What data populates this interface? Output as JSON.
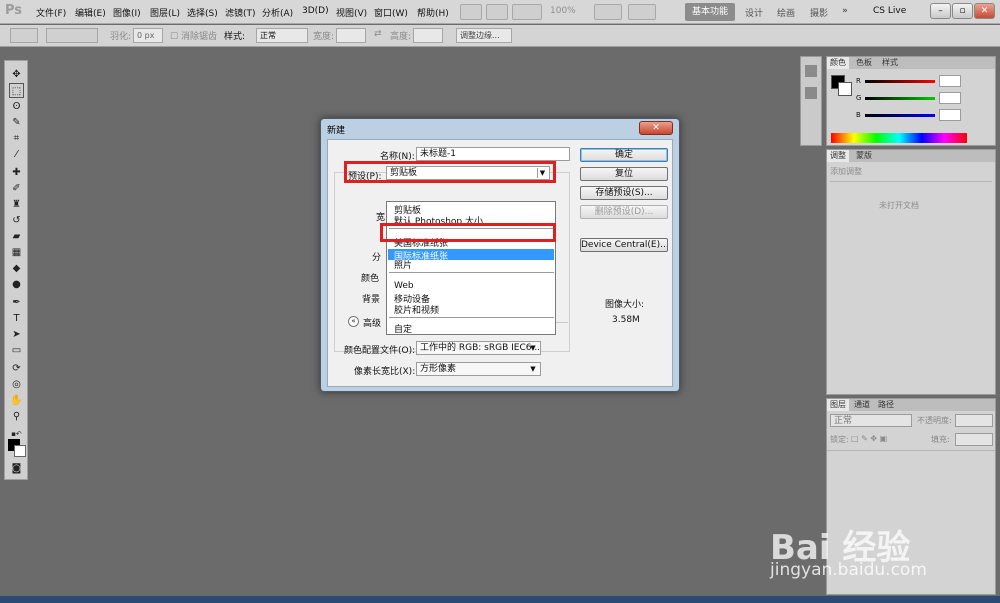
{
  "menubar": {
    "logo": "Ps",
    "items": [
      "文件(F)",
      "编辑(E)",
      "图像(I)",
      "图层(L)",
      "选择(S)",
      "滤镜(T)",
      "分析(A)",
      "3D(D)",
      "视图(V)",
      "窗口(W)",
      "帮助(H)"
    ],
    "zoom": "100%",
    "workspaces": [
      "基本功能",
      "设计",
      "绘画",
      "摄影",
      "»"
    ],
    "cs_live": "CS Live",
    "window_controls": [
      "–",
      "▫",
      "✕"
    ]
  },
  "optionsbar": {
    "feather_label": "羽化:",
    "feather_value": "0 px",
    "antialias_label": "消除锯齿",
    "style_label": "样式:",
    "style_value": "正常",
    "width_label": "宽度:",
    "height_label": "高度:",
    "refine_edge": "调整边缘..."
  },
  "panels": {
    "color_tabs": [
      "颜色",
      "色板",
      "样式"
    ],
    "rgb_labels": [
      "R",
      "G",
      "B"
    ],
    "adjust_tabs": [
      "调整",
      "蒙版"
    ],
    "adjust_header": "添加调整",
    "adjust_empty": "未打开文档",
    "layers_tabs": [
      "图层",
      "通道",
      "路径"
    ],
    "blend_mode": "正常",
    "opacity_label": "不透明度:",
    "lock_label": "锁定:",
    "fill_label": "填充:"
  },
  "dialog": {
    "title": "新建",
    "close": "✕",
    "name_label": "名称(N):",
    "name_value": "未标题-1",
    "preset_label": "预设(P):",
    "preset_value": "剪贴板",
    "partial_labels": [
      "宽",
      "分",
      "颜色",
      "背景"
    ],
    "advanced_label": "高级",
    "color_profile_label": "颜色配置文件(O):",
    "color_profile_value": "工作中的 RGB: sRGB IEC6...",
    "pixel_aspect_label": "像素长宽比(X):",
    "pixel_aspect_value": "方形像素",
    "buttons": {
      "ok": "确定",
      "reset": "复位",
      "save_preset": "存储预设(S)...",
      "delete_preset": "删除预设(D)...",
      "device_central": "Device Central(E)..."
    },
    "image_size_label": "图像大小:",
    "image_size_value": "3.58M",
    "preset_options": {
      "clipboard": "剪贴板",
      "default": "默认 Photoshop 大小",
      "us_paper": "美国标准纸张",
      "intl_paper": "国际标准纸张",
      "photo": "照片",
      "web": "Web",
      "mobile": "移动设备",
      "film_video": "胶片和视频",
      "custom": "自定"
    }
  },
  "watermark": {
    "brand": "Bai 经验",
    "url": "jingyan.baidu.com"
  },
  "colors": {
    "workspace_bg": "#6b6b6b",
    "highlight": "#3399ff",
    "annotation_red": "#e02020"
  }
}
